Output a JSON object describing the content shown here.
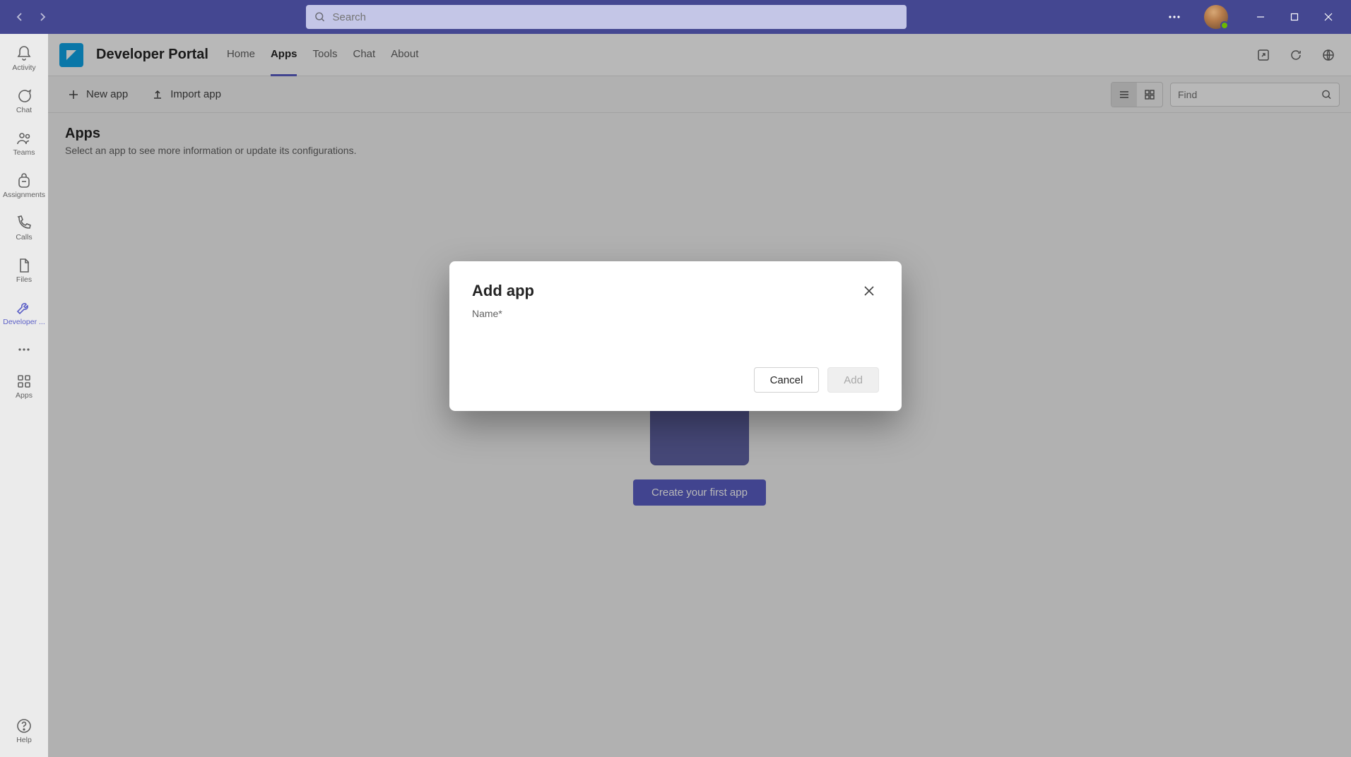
{
  "search": {
    "placeholder": "Search"
  },
  "rail": {
    "items": [
      {
        "label": "Activity"
      },
      {
        "label": "Chat"
      },
      {
        "label": "Teams"
      },
      {
        "label": "Assignments"
      },
      {
        "label": "Calls"
      },
      {
        "label": "Files"
      },
      {
        "label": "Developer ..."
      }
    ],
    "apps_label": "Apps",
    "help_label": "Help"
  },
  "header": {
    "title": "Developer Portal",
    "tabs": [
      {
        "label": "Home"
      },
      {
        "label": "Apps"
      },
      {
        "label": "Tools"
      },
      {
        "label": "Chat"
      },
      {
        "label": "About"
      }
    ],
    "active_tab_index": 1
  },
  "toolbar": {
    "new_app": "New app",
    "import_app": "Import app",
    "find_placeholder": "Find"
  },
  "page": {
    "title": "Apps",
    "subtitle": "Select an app to see more information or update its configurations.",
    "cta": "Create your first app"
  },
  "dialog": {
    "title": "Add app",
    "name_label": "Name*",
    "cancel": "Cancel",
    "add": "Add"
  }
}
